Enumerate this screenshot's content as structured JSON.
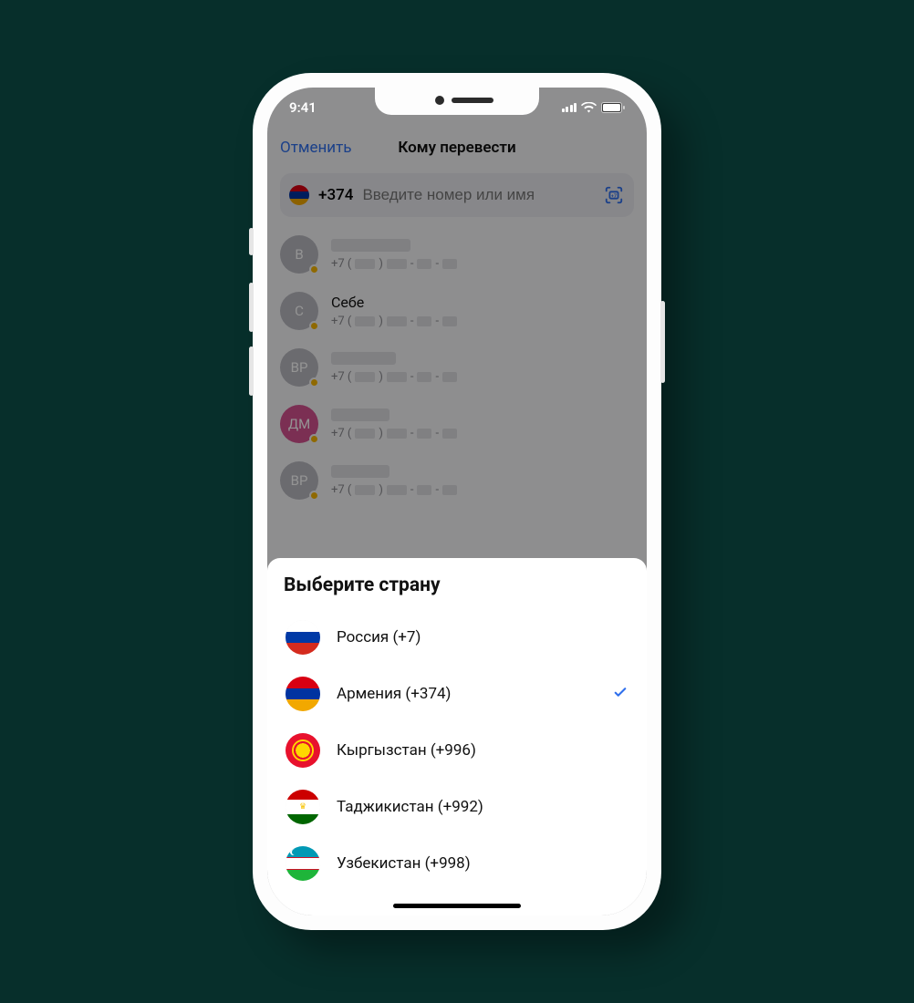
{
  "status": {
    "time": "9:41"
  },
  "nav": {
    "cancel": "Отменить",
    "title": "Кому перевести"
  },
  "search": {
    "code": "+374",
    "placeholder": "Введите номер или имя"
  },
  "contacts": [
    {
      "initials": "В",
      "avatar": "grey",
      "name_hidden": true,
      "phone_prefix": "+7 (",
      "known_name": ""
    },
    {
      "initials": "С",
      "avatar": "grey",
      "name_hidden": false,
      "phone_prefix": "+7 (",
      "known_name": "Себе"
    },
    {
      "initials": "ВР",
      "avatar": "grey",
      "name_hidden": true,
      "phone_prefix": "+7 (",
      "known_name": ""
    },
    {
      "initials": "ДМ",
      "avatar": "pink",
      "name_hidden": true,
      "phone_prefix": "+7 (",
      "known_name": ""
    },
    {
      "initials": "ВР",
      "avatar": "grey",
      "name_hidden": true,
      "phone_prefix": "+7 (",
      "known_name": ""
    }
  ],
  "sheet": {
    "title": "Выберите страну",
    "countries": [
      {
        "id": "ru",
        "label": "Россия (+7)",
        "selected": false
      },
      {
        "id": "am",
        "label": "Армения (+374)",
        "selected": true
      },
      {
        "id": "kg",
        "label": "Кыргызстан (+996)",
        "selected": false
      },
      {
        "id": "tj",
        "label": "Таджикистан (+992)",
        "selected": false
      },
      {
        "id": "uz",
        "label": "Узбекистан (+998)",
        "selected": false
      }
    ]
  },
  "icons": {
    "scan": "card-scan-icon",
    "signal": "cellular-signal-icon",
    "wifi": "wifi-icon",
    "battery": "battery-icon",
    "check": "checkmark-icon"
  }
}
